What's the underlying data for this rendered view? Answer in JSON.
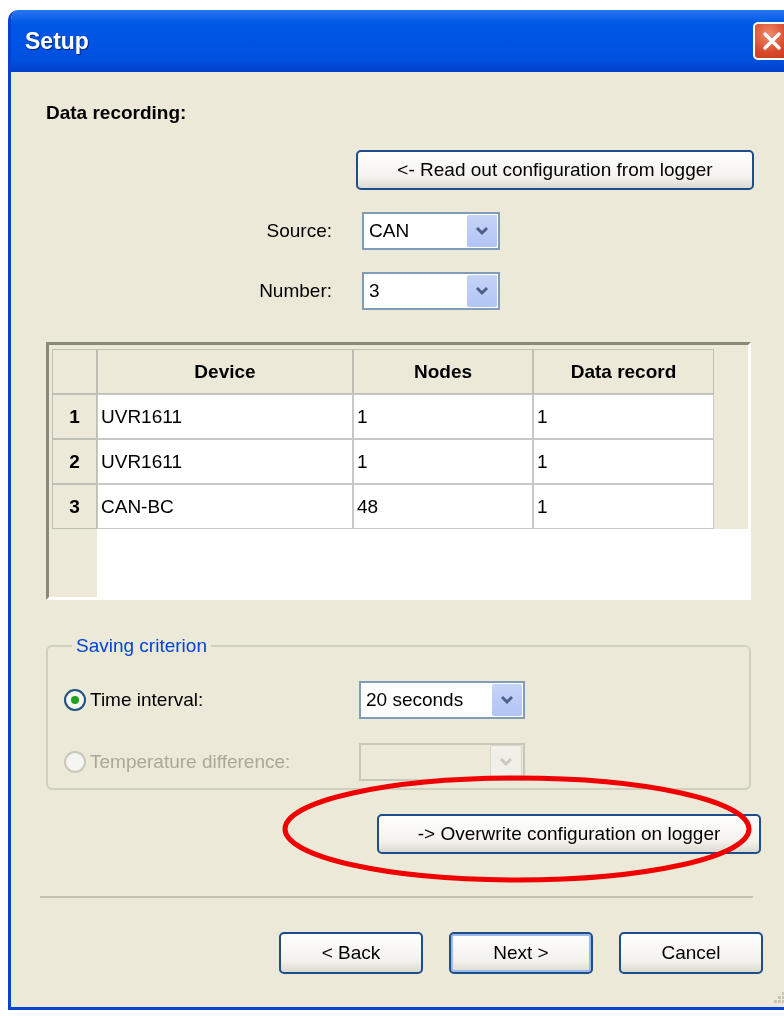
{
  "window": {
    "title": "Setup"
  },
  "section_title": "Data recording:",
  "read_button": {
    "label": "<- Read out configuration from logger"
  },
  "source": {
    "label": "Source:",
    "value": "CAN"
  },
  "number": {
    "label": "Number:",
    "value": "3"
  },
  "table": {
    "columns": [
      "Device",
      "Nodes",
      "Data record"
    ],
    "rows": [
      {
        "index": "1",
        "cells": [
          "UVR1611",
          "1",
          "1"
        ]
      },
      {
        "index": "2",
        "cells": [
          "UVR1611",
          "1",
          "1"
        ]
      },
      {
        "index": "3",
        "cells": [
          "CAN-BC",
          "48",
          "1"
        ]
      }
    ]
  },
  "saving_criterion": {
    "legend": "Saving criterion",
    "options": [
      {
        "label": "Time interval:",
        "selected": true,
        "disabled": false,
        "value": "20 seconds"
      },
      {
        "label": "Temperature difference:",
        "selected": false,
        "disabled": true
      }
    ]
  },
  "overwrite_button": {
    "label": "-> Overwrite configuration on logger"
  },
  "highlight": {
    "kind": "ellipse"
  },
  "buttons": [
    {
      "label": "< Back",
      "default": false
    },
    {
      "label": "Next >",
      "default": true
    },
    {
      "label": "Cancel",
      "default": false
    }
  ]
}
